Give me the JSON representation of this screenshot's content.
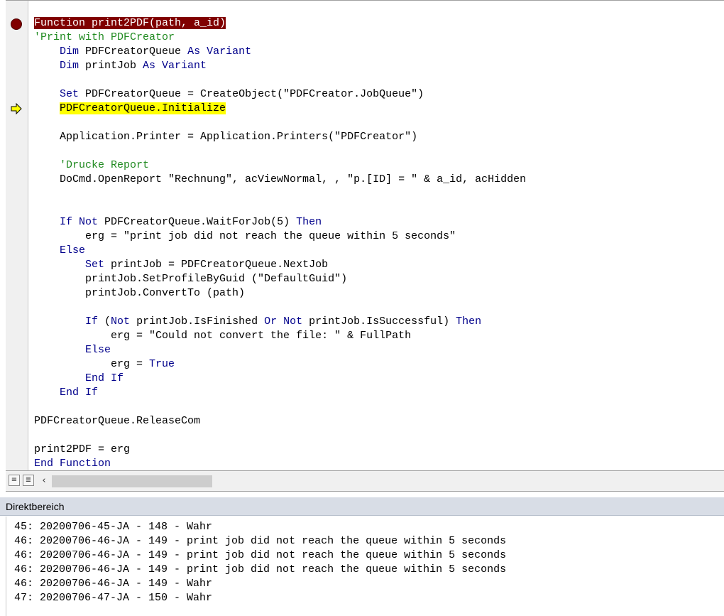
{
  "editor": {
    "lines": [
      {
        "kind": "breakpoint",
        "parts": [
          {
            "t": "Function print2PDF(path, a_id)",
            "c": "hl-break"
          }
        ]
      },
      {
        "kind": "plain",
        "parts": [
          {
            "t": "'Print with PDFCreator",
            "c": "cm"
          }
        ]
      },
      {
        "kind": "plain",
        "parts": [
          {
            "t": "    "
          },
          {
            "t": "Dim",
            "c": "kw"
          },
          {
            "t": " PDFCreatorQueue "
          },
          {
            "t": "As Variant",
            "c": "kw"
          }
        ]
      },
      {
        "kind": "plain",
        "parts": [
          {
            "t": "    "
          },
          {
            "t": "Dim",
            "c": "kw"
          },
          {
            "t": " printJob "
          },
          {
            "t": "As Variant",
            "c": "kw"
          }
        ]
      },
      {
        "kind": "plain",
        "parts": [
          {
            "t": ""
          }
        ]
      },
      {
        "kind": "plain",
        "parts": [
          {
            "t": "    "
          },
          {
            "t": "Set",
            "c": "kw"
          },
          {
            "t": " PDFCreatorQueue = CreateObject(\"PDFCreator.JobQueue\")"
          }
        ]
      },
      {
        "kind": "exec",
        "parts": [
          {
            "t": "    "
          },
          {
            "t": "PDFCreatorQueue.Initialize",
            "c": "hl-exec"
          }
        ]
      },
      {
        "kind": "plain",
        "parts": [
          {
            "t": ""
          }
        ]
      },
      {
        "kind": "plain",
        "parts": [
          {
            "t": "    Application.Printer = Application.Printers(\"PDFCreator\")"
          }
        ]
      },
      {
        "kind": "plain",
        "parts": [
          {
            "t": ""
          }
        ]
      },
      {
        "kind": "plain",
        "parts": [
          {
            "t": "    "
          },
          {
            "t": "'Drucke Report",
            "c": "cm"
          }
        ]
      },
      {
        "kind": "plain",
        "parts": [
          {
            "t": "    DoCmd.OpenReport \"Rechnung\", acViewNormal, , \"p.[ID] = \" & a_id, acHidden"
          }
        ]
      },
      {
        "kind": "plain",
        "parts": [
          {
            "t": ""
          }
        ]
      },
      {
        "kind": "plain",
        "parts": [
          {
            "t": ""
          }
        ]
      },
      {
        "kind": "plain",
        "parts": [
          {
            "t": "    "
          },
          {
            "t": "If Not",
            "c": "kw"
          },
          {
            "t": " PDFCreatorQueue.WaitForJob(5) "
          },
          {
            "t": "Then",
            "c": "kw"
          }
        ]
      },
      {
        "kind": "plain",
        "parts": [
          {
            "t": "        erg = \"print job did not reach the queue within 5 seconds\""
          }
        ]
      },
      {
        "kind": "plain",
        "parts": [
          {
            "t": "    "
          },
          {
            "t": "Else",
            "c": "kw"
          }
        ]
      },
      {
        "kind": "plain",
        "parts": [
          {
            "t": "        "
          },
          {
            "t": "Set",
            "c": "kw"
          },
          {
            "t": " printJob = PDFCreatorQueue.NextJob"
          }
        ]
      },
      {
        "kind": "plain",
        "parts": [
          {
            "t": "        printJob.SetProfileByGuid (\"DefaultGuid\")"
          }
        ]
      },
      {
        "kind": "plain",
        "parts": [
          {
            "t": "        printJob.ConvertTo (path)"
          }
        ]
      },
      {
        "kind": "plain",
        "parts": [
          {
            "t": ""
          }
        ]
      },
      {
        "kind": "plain",
        "parts": [
          {
            "t": "        "
          },
          {
            "t": "If",
            "c": "kw"
          },
          {
            "t": " ("
          },
          {
            "t": "Not",
            "c": "kw"
          },
          {
            "t": " printJob.IsFinished "
          },
          {
            "t": "Or Not",
            "c": "kw"
          },
          {
            "t": " printJob.IsSuccessful) "
          },
          {
            "t": "Then",
            "c": "kw"
          }
        ]
      },
      {
        "kind": "plain",
        "parts": [
          {
            "t": "            erg = \"Could not convert the file: \" & FullPath"
          }
        ]
      },
      {
        "kind": "plain",
        "parts": [
          {
            "t": "        "
          },
          {
            "t": "Else",
            "c": "kw"
          }
        ]
      },
      {
        "kind": "plain",
        "parts": [
          {
            "t": "            erg = "
          },
          {
            "t": "True",
            "c": "kw"
          }
        ]
      },
      {
        "kind": "plain",
        "parts": [
          {
            "t": "        "
          },
          {
            "t": "End If",
            "c": "kw"
          }
        ]
      },
      {
        "kind": "plain",
        "parts": [
          {
            "t": "    "
          },
          {
            "t": "End If",
            "c": "kw"
          }
        ]
      },
      {
        "kind": "plain",
        "parts": [
          {
            "t": ""
          }
        ]
      },
      {
        "kind": "plain",
        "parts": [
          {
            "t": "PDFCreatorQueue.ReleaseCom"
          }
        ]
      },
      {
        "kind": "plain",
        "parts": [
          {
            "t": ""
          }
        ]
      },
      {
        "kind": "plain",
        "parts": [
          {
            "t": "print2PDF = erg"
          }
        ]
      },
      {
        "kind": "plain",
        "parts": [
          {
            "t": "End Function",
            "c": "kw"
          }
        ]
      }
    ]
  },
  "icons": {
    "breakpoint": "breakpoint-dot-icon",
    "execution": "execution-arrow-icon",
    "procedure_view": "procedure-view-icon",
    "full_module_view": "full-module-view-icon",
    "scroll_left": "chevron-left-icon"
  },
  "colors": {
    "keyword": "#00008b",
    "comment": "#228b22",
    "breakpoint_bg": "#800000",
    "exec_bg": "#ffff00"
  },
  "immediate": {
    "title": "Direktbereich",
    "lines": [
      "45: 20200706-45-JA - 148 - Wahr",
      "46: 20200706-46-JA - 149 - print job did not reach the queue within 5 seconds",
      "46: 20200706-46-JA - 149 - print job did not reach the queue within 5 seconds",
      "46: 20200706-46-JA - 149 - print job did not reach the queue within 5 seconds",
      "46: 20200706-46-JA - 149 - Wahr",
      "47: 20200706-47-JA - 150 - Wahr"
    ]
  }
}
